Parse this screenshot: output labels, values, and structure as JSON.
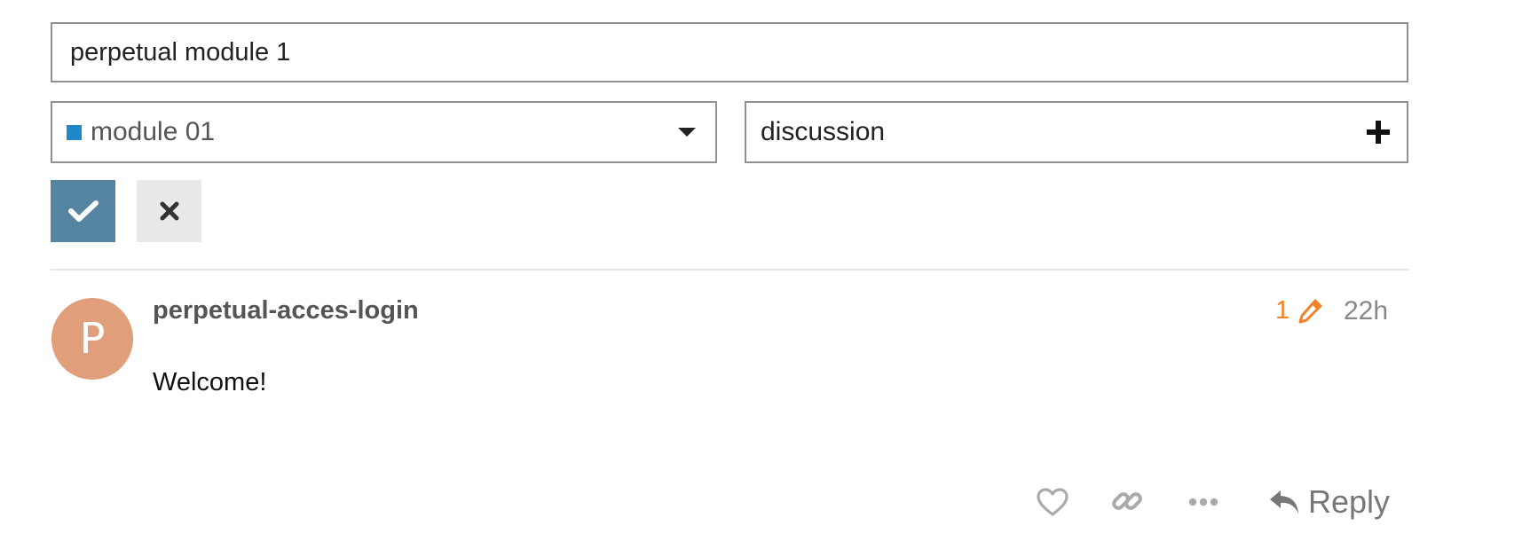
{
  "colors": {
    "category_swatch": "#1e88c8",
    "save_bg": "#5584a0",
    "cancel_bg": "#e9e9e9",
    "avatar_bg": "#e09e7b",
    "edits_color": "#f0822c",
    "muted": "#888888"
  },
  "editor": {
    "title_value": "perpetual module 1",
    "category": {
      "label": "module 01",
      "icon": "caret-down-icon"
    },
    "tags": {
      "label": "discussion",
      "icon": "plus-icon"
    },
    "save_icon": "check-icon",
    "cancel_icon": "close-icon"
  },
  "post": {
    "avatar_letter": "P",
    "username": "perpetual-acces-login",
    "edit_count": "1",
    "edit_icon": "pencil-icon",
    "time": "22h",
    "body": "Welcome!"
  },
  "actions": {
    "like_icon": "heart-icon",
    "link_icon": "link-icon",
    "more_icon": "ellipsis-icon",
    "reply_icon": "reply-icon",
    "reply_label": "Reply"
  }
}
